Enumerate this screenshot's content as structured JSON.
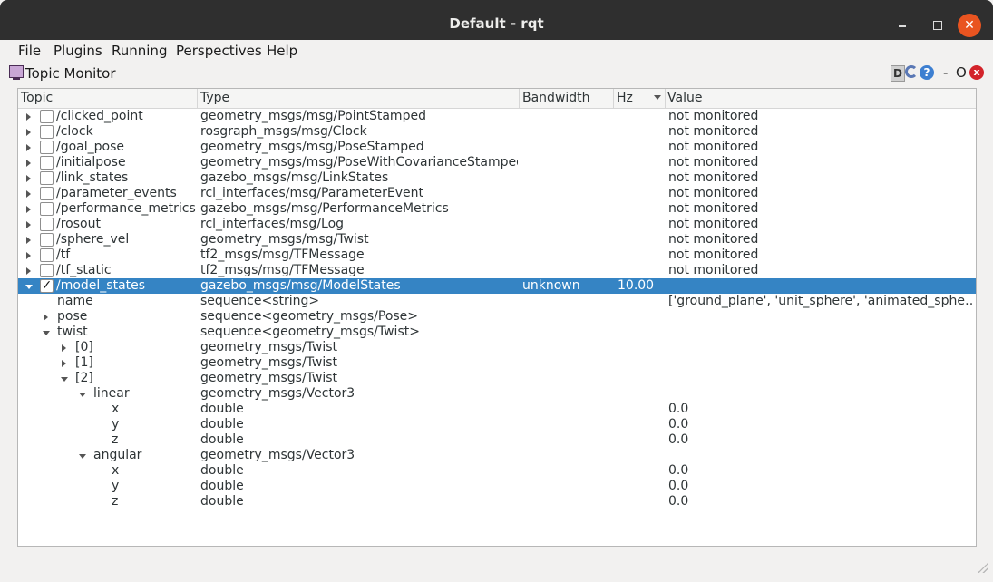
{
  "window": {
    "title": "Default - rqt"
  },
  "menu": [
    {
      "label": "File"
    },
    {
      "label": "Plugins"
    },
    {
      "label": "Running"
    },
    {
      "label": "Perspectives"
    },
    {
      "label": "Help"
    }
  ],
  "plugin": {
    "title": "Topic Monitor",
    "d_label": "D",
    "help_label": "?",
    "dash_label": "-",
    "o_label": "O",
    "close_label": "x"
  },
  "columns": {
    "topic": "Topic",
    "type": "Type",
    "bandwidth": "Bandwidth",
    "hz": "Hz",
    "value": "Value"
  },
  "rows": [
    {
      "topic": "/clicked_point",
      "type": "geometry_msgs/msg/PointStamped",
      "bandwidth": "",
      "hz": "",
      "value": "not monitored"
    },
    {
      "topic": "/clock",
      "type": "rosgraph_msgs/msg/Clock",
      "bandwidth": "",
      "hz": "",
      "value": "not monitored"
    },
    {
      "topic": "/goal_pose",
      "type": "geometry_msgs/msg/PoseStamped",
      "bandwidth": "",
      "hz": "",
      "value": "not monitored"
    },
    {
      "topic": "/initialpose",
      "type": "geometry_msgs/msg/PoseWithCovarianceStamped",
      "bandwidth": "",
      "hz": "",
      "value": "not monitored"
    },
    {
      "topic": "/link_states",
      "type": "gazebo_msgs/msg/LinkStates",
      "bandwidth": "",
      "hz": "",
      "value": "not monitored"
    },
    {
      "topic": "/parameter_events",
      "type": "rcl_interfaces/msg/ParameterEvent",
      "bandwidth": "",
      "hz": "",
      "value": "not monitored"
    },
    {
      "topic": "/performance_metrics",
      "type": "gazebo_msgs/msg/PerformanceMetrics",
      "bandwidth": "",
      "hz": "",
      "value": "not monitored"
    },
    {
      "topic": "/rosout",
      "type": "rcl_interfaces/msg/Log",
      "bandwidth": "",
      "hz": "",
      "value": "not monitored"
    },
    {
      "topic": "/sphere_vel",
      "type": "geometry_msgs/msg/Twist",
      "bandwidth": "",
      "hz": "",
      "value": "not monitored"
    },
    {
      "topic": "/tf",
      "type": "tf2_msgs/msg/TFMessage",
      "bandwidth": "",
      "hz": "",
      "value": "not monitored"
    },
    {
      "topic": "/tf_static",
      "type": "tf2_msgs/msg/TFMessage",
      "bandwidth": "",
      "hz": "",
      "value": "not monitored"
    },
    {
      "topic": "/model_states",
      "type": "gazebo_msgs/msg/ModelStates",
      "bandwidth": "unknown",
      "hz": "10.00",
      "value": "",
      "checked": true,
      "selected": true
    },
    {
      "topic": "name",
      "type": "sequence<string>",
      "bandwidth": "",
      "hz": "",
      "value": "['ground_plane', 'unit_sphere', 'animated_sphe…"
    },
    {
      "topic": "pose",
      "type": "sequence<geometry_msgs/Pose>",
      "bandwidth": "",
      "hz": "",
      "value": ""
    },
    {
      "topic": "twist",
      "type": "sequence<geometry_msgs/Twist>",
      "bandwidth": "",
      "hz": "",
      "value": ""
    },
    {
      "topic": "[0]",
      "type": "geometry_msgs/Twist",
      "bandwidth": "",
      "hz": "",
      "value": ""
    },
    {
      "topic": "[1]",
      "type": "geometry_msgs/Twist",
      "bandwidth": "",
      "hz": "",
      "value": ""
    },
    {
      "topic": "[2]",
      "type": "geometry_msgs/Twist",
      "bandwidth": "",
      "hz": "",
      "value": ""
    },
    {
      "topic": "linear",
      "type": "geometry_msgs/Vector3",
      "bandwidth": "",
      "hz": "",
      "value": ""
    },
    {
      "topic": "x",
      "type": "double",
      "bandwidth": "",
      "hz": "",
      "value": "0.0"
    },
    {
      "topic": "y",
      "type": "double",
      "bandwidth": "",
      "hz": "",
      "value": "0.0"
    },
    {
      "topic": "z",
      "type": "double",
      "bandwidth": "",
      "hz": "",
      "value": "0.0"
    },
    {
      "topic": "angular",
      "type": "geometry_msgs/Vector3",
      "bandwidth": "",
      "hz": "",
      "value": ""
    },
    {
      "topic": "x",
      "type": "double",
      "bandwidth": "",
      "hz": "",
      "value": "0.0"
    },
    {
      "topic": "y",
      "type": "double",
      "bandwidth": "",
      "hz": "",
      "value": "0.0"
    },
    {
      "topic": "z",
      "type": "double",
      "bandwidth": "",
      "hz": "",
      "value": "0.0"
    }
  ],
  "colors": {
    "selection": "#3584c4",
    "titlebar": "#2f2f2f",
    "close_button": "#e95420"
  }
}
